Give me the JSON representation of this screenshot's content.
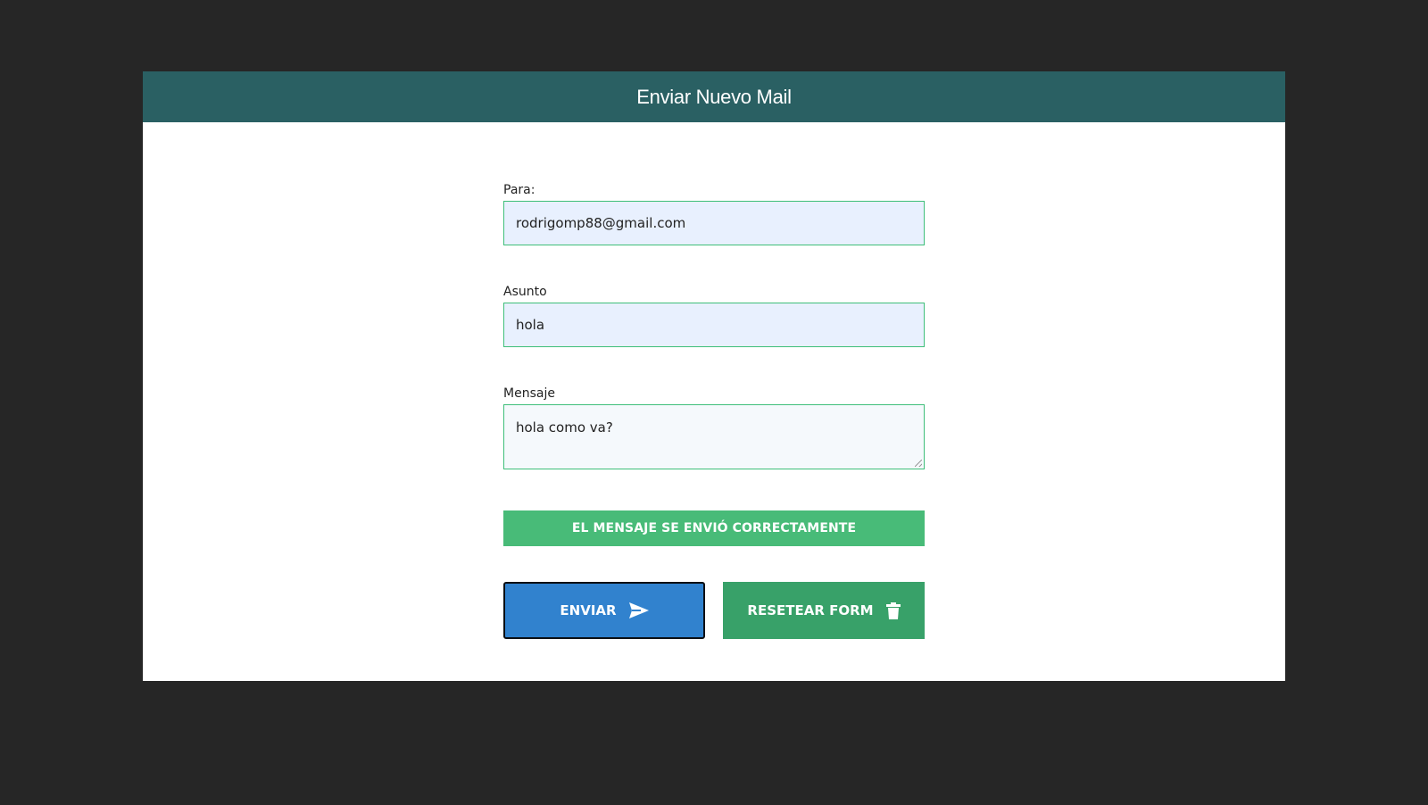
{
  "header": {
    "title": "Enviar Nuevo Mail"
  },
  "form": {
    "to": {
      "label": "Para:",
      "value": "rodrigomp88@gmail.com"
    },
    "subject": {
      "label": "Asunto",
      "value": "hola"
    },
    "message": {
      "label": "Mensaje",
      "value": "hola como va?"
    }
  },
  "status": {
    "success_text": "EL MENSAJE SE ENVIÓ CORRECTAMENTE",
    "color": "#48bb78"
  },
  "actions": {
    "send": {
      "label": "ENVIAR",
      "icon": "send-icon",
      "color": "#3182ce"
    },
    "reset": {
      "label": "RESETEAR FORM",
      "icon": "trash-icon",
      "color": "#38a169"
    }
  },
  "theme": {
    "header_color": "#2a6063",
    "page_background": "#262626",
    "input_border": "#3fbf7a"
  }
}
